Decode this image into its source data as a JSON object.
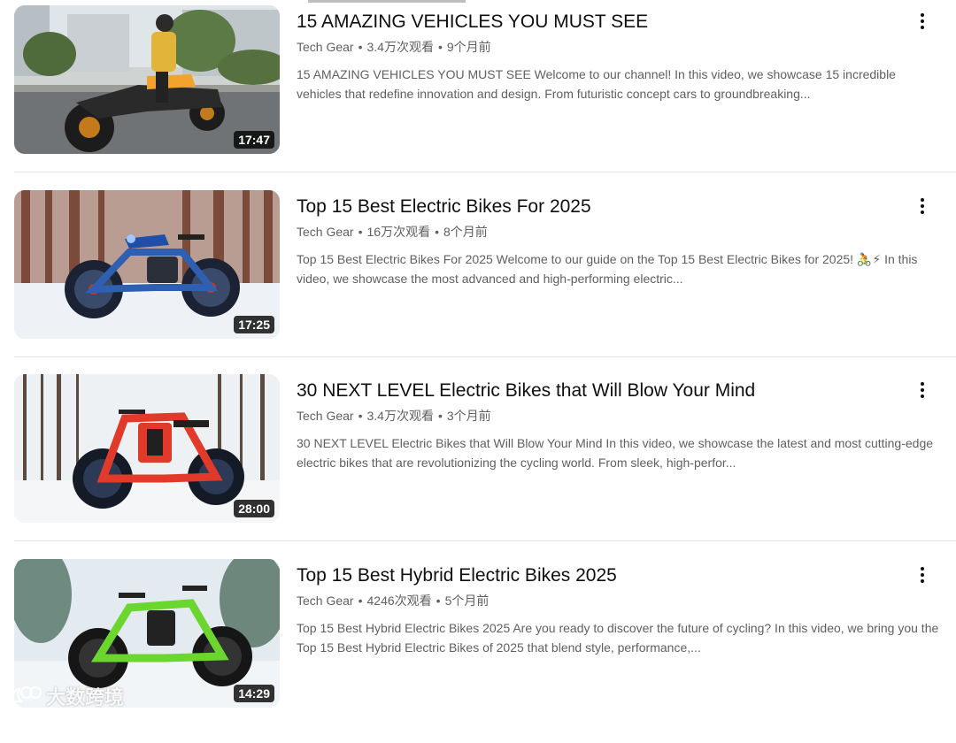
{
  "videos": [
    {
      "title": "15 AMAZING VEHICLES YOU MUST SEE",
      "channel": "Tech Gear",
      "views": "3.4万次观看",
      "age": "9个月前",
      "description": "15 AMAZING VEHICLES YOU MUST SEE Welcome to our channel! In this video, we showcase 15 incredible vehicles that redefine innovation and design. From futuristic concept cars to groundbreaking...",
      "duration": "17:47",
      "thumbnail": "motorcycle-trike-street"
    },
    {
      "title": "Top 15 Best Electric Bikes For 2025",
      "channel": "Tech Gear",
      "views": "16万次观看",
      "age": "8个月前",
      "description": "Top 15 Best Electric Bikes For 2025 Welcome to our guide on the Top 15 Best Electric Bikes for 2025! 🚴⚡ In this video, we showcase the most advanced and high-performing electric...",
      "duration": "17:25",
      "thumbnail": "blue-ebike-snow-forest"
    },
    {
      "title": "30 NEXT LEVEL Electric Bikes that Will Blow Your Mind",
      "channel": "Tech Gear",
      "views": "3.4万次观看",
      "age": "3个月前",
      "description": "30 NEXT LEVEL Electric Bikes that Will Blow Your Mind In this video, we showcase the latest and most cutting-edge electric bikes that are revolutionizing the cycling world. From sleek, high-perfor...",
      "duration": "28:00",
      "thumbnail": "red-ebike-snow"
    },
    {
      "title": "Top 15 Best Hybrid Electric Bikes 2025",
      "channel": "Tech Gear",
      "views": "4246次观看",
      "age": "5个月前",
      "description": "Top 15 Best Hybrid Electric Bikes 2025 Are you ready to discover the future of cycling? In this video, we bring you the Top 15 Best Hybrid Electric Bikes of 2025 that blend style, performance,...",
      "duration": "14:29",
      "thumbnail": "green-ebike-snow"
    }
  ],
  "watermark": {
    "text": "大数跨境"
  }
}
